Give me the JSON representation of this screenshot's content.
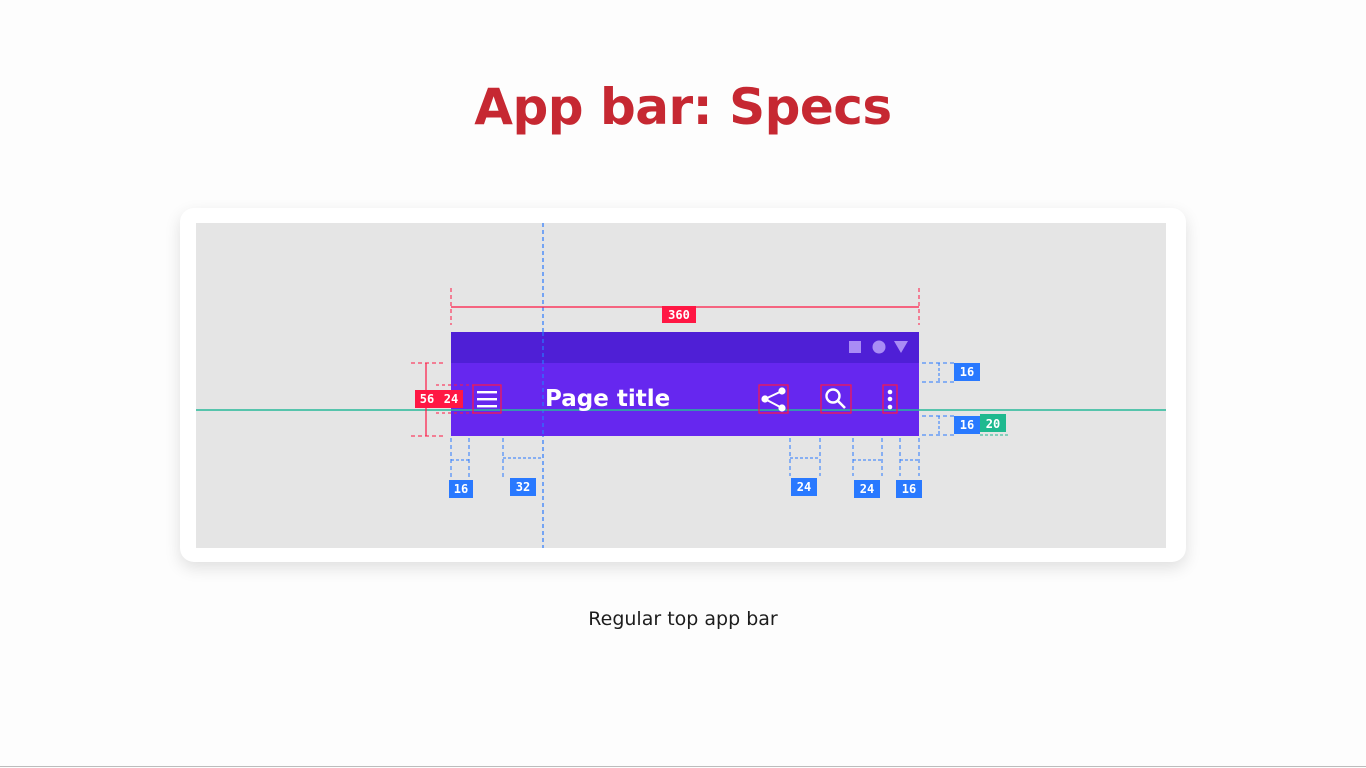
{
  "heading": "App bar: Specs",
  "caption": "Regular top app bar",
  "appbar": {
    "title": "Page title",
    "status_icons": [
      "square-icon",
      "circle-icon",
      "triangle-icon"
    ],
    "nav_icon": "menu-icon",
    "action_icons": [
      "share-icon",
      "search-icon",
      "more-vert-icon"
    ]
  },
  "measurements": {
    "width": "360",
    "height": "56",
    "icon_size": "24",
    "status_gap_top": "16",
    "bottom_gap": "16",
    "baseline": "20",
    "left_margin": "16",
    "title_offset": "32",
    "action_gap_1": "24",
    "action_gap_2": "24",
    "right_margin": "16"
  },
  "colors": {
    "heading": "#c62832",
    "appbar": "#6200ee",
    "status_bar": "#4b1fd3",
    "spec_red": "#ff1744",
    "spec_blue": "#2979ff",
    "spec_teal": "#1de9b6"
  }
}
